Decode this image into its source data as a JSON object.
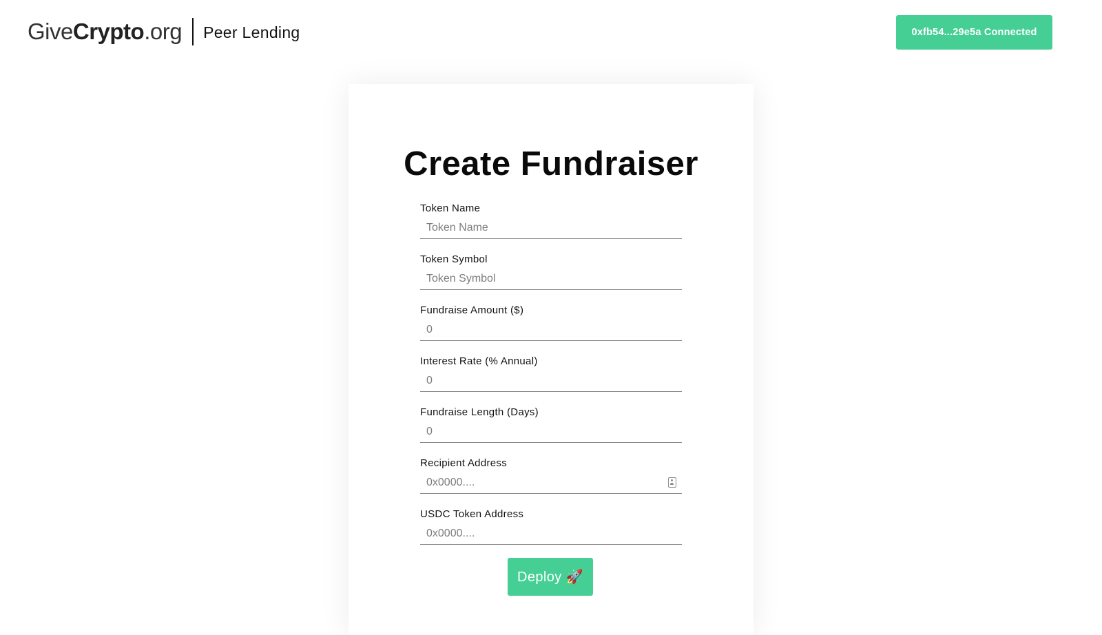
{
  "header": {
    "logo": {
      "give": "Give",
      "crypto": "Crypto",
      "tld": ".org",
      "subtitle": "Peer Lending"
    },
    "wallet_button_label": "0xfb54...29e5a Connected"
  },
  "form": {
    "title": "Create Fundraiser",
    "fields": [
      {
        "label": "Token Name",
        "placeholder": "Token Name",
        "value": ""
      },
      {
        "label": "Token Symbol",
        "placeholder": "Token Symbol",
        "value": ""
      },
      {
        "label": "Fundraise Amount ($)",
        "placeholder": "0",
        "value": ""
      },
      {
        "label": "Interest Rate (% Annual)",
        "placeholder": "0",
        "value": ""
      },
      {
        "label": "Fundraise Length (Days)",
        "placeholder": "0",
        "value": ""
      },
      {
        "label": "Recipient Address",
        "placeholder": "0x0000....",
        "value": "",
        "icon": "contact-card-icon"
      },
      {
        "label": "USDC Token Address",
        "placeholder": "0x0000....",
        "value": ""
      }
    ],
    "deploy_label": "Deploy 🚀"
  },
  "colors": {
    "accent": "#45cf94",
    "text": "#111111",
    "underline": "#8a8a8a"
  }
}
